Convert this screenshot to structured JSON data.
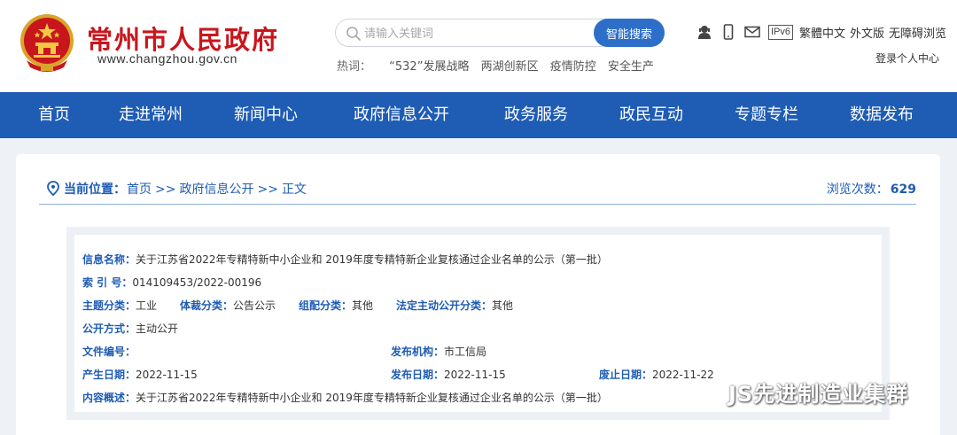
{
  "header": {
    "site_title": "常州市人民政府",
    "site_url": "www.changzhou.gov.cn",
    "search": {
      "placeholder": "请输入关键词",
      "button_label": "智能搜索"
    },
    "hot_words": {
      "label": "热词：",
      "items": [
        "“532”发展战略",
        "两湖创新区",
        "疫情防控",
        "安全生产"
      ]
    },
    "tools": {
      "ipv6_label": "IPv6",
      "links": [
        "繁體中文",
        "外文版",
        "无障碍浏览"
      ],
      "login": "登录个人中心"
    },
    "icons": [
      "user-service-icon",
      "mobile-icon",
      "mail-icon"
    ]
  },
  "nav": {
    "items": [
      "首页",
      "走进常州",
      "新闻中心",
      "政府信息公开",
      "政务服务",
      "政民互动",
      "专题专栏",
      "数据发布"
    ]
  },
  "location": {
    "label": "当前位置：",
    "crumbs": [
      "首页",
      "政府信息公开",
      "正文"
    ],
    "separator": ">>",
    "views_label": "浏览次数：",
    "views_count": "629"
  },
  "meta": {
    "info_name": {
      "label": "信息名称：",
      "value": "关于江苏省2022年专精特新中小企业和 2019年度专精特新企业复核通过企业名单的公示（第一批）"
    },
    "index_no": {
      "label": "索 引 号：",
      "value": "014109453/2022-00196"
    },
    "topic": {
      "label": "主题分类：",
      "value": "工业"
    },
    "genre": {
      "label": "体裁分类：",
      "value": "公告公示"
    },
    "org_class": {
      "label": "组配分类：",
      "value": "其他"
    },
    "legal_class": {
      "label": "法定主动公开分类：",
      "value": "其他"
    },
    "disclosure": {
      "label": "公开方式：",
      "value": "主动公开"
    },
    "doc_no": {
      "label": "文件编号：",
      "value": ""
    },
    "publisher": {
      "label": "发布机构：",
      "value": "市工信局"
    },
    "created": {
      "label": "产生日期：",
      "value": "2022-11-15"
    },
    "published": {
      "label": "发布日期：",
      "value": "2022-11-15"
    },
    "expires": {
      "label": "废止日期：",
      "value": "2022-11-22"
    },
    "summary": {
      "label": "内容概述：",
      "value": "关于江苏省2022年专精特新中小企业和 2019年度专精特新企业复核通过企业名单的公示（第一批）"
    }
  },
  "watermark": {
    "text": "JS先进制造业集群"
  },
  "colors": {
    "brand_red": "#c8161d",
    "nav_blue": "#1f5cb4",
    "button_blue": "#2d6fc8",
    "page_bg": "#eef1f5"
  }
}
